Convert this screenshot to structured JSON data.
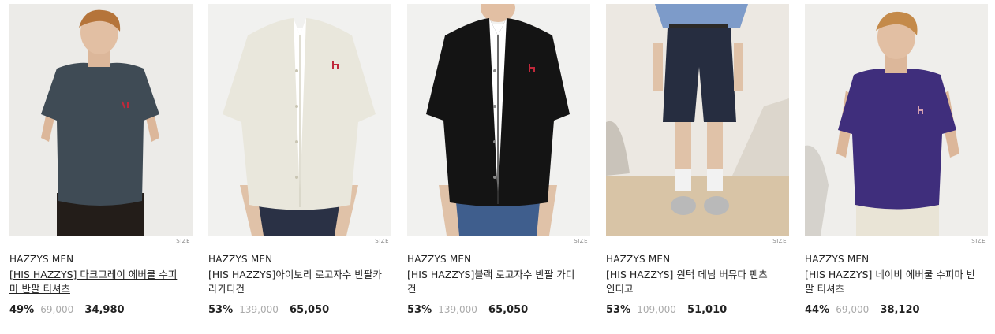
{
  "products": [
    {
      "brand": "HAZZYS MEN",
      "name": "[HIS HAZZYS] 다크그레이 에버쿨 수피마 반팔 티셔츠",
      "discount": "49%",
      "original_price": "69,000",
      "sale_price": "34,980",
      "size_label": "SIZE",
      "colors": {
        "bg": "#ecebe8",
        "garment": "#3f4b55"
      }
    },
    {
      "brand": "HAZZYS MEN",
      "name": "[HIS HAZZYS]아이보리 로고자수 반팔카라가디건",
      "discount": "53%",
      "original_price": "139,000",
      "sale_price": "65,050",
      "size_label": "SIZE",
      "colors": {
        "bg": "#f1f1ef",
        "garment": "#e9e7dc"
      }
    },
    {
      "brand": "HAZZYS MEN",
      "name": "[HIS HAZZYS]블랙 로고자수 반팔 가디건",
      "discount": "53%",
      "original_price": "139,000",
      "sale_price": "65,050",
      "size_label": "SIZE",
      "colors": {
        "bg": "#f1f1ef",
        "garment": "#141414"
      }
    },
    {
      "brand": "HAZZYS MEN",
      "name": "[HIS HAZZYS] 원턱 데님 버뮤다 팬츠_ 인디고",
      "discount": "53%",
      "original_price": "109,000",
      "sale_price": "51,010",
      "size_label": "SIZE",
      "colors": {
        "bg": "#ece8e2",
        "garment": "#262d40"
      }
    },
    {
      "brand": "HAZZYS MEN",
      "name": "[HIS HAZZYS] 네이비 에버쿨 수피마 반팔 티셔츠",
      "discount": "44%",
      "original_price": "69,000",
      "sale_price": "38,120",
      "size_label": "SIZE",
      "colors": {
        "bg": "#efeeeb",
        "garment": "#3f2e7c"
      }
    }
  ]
}
